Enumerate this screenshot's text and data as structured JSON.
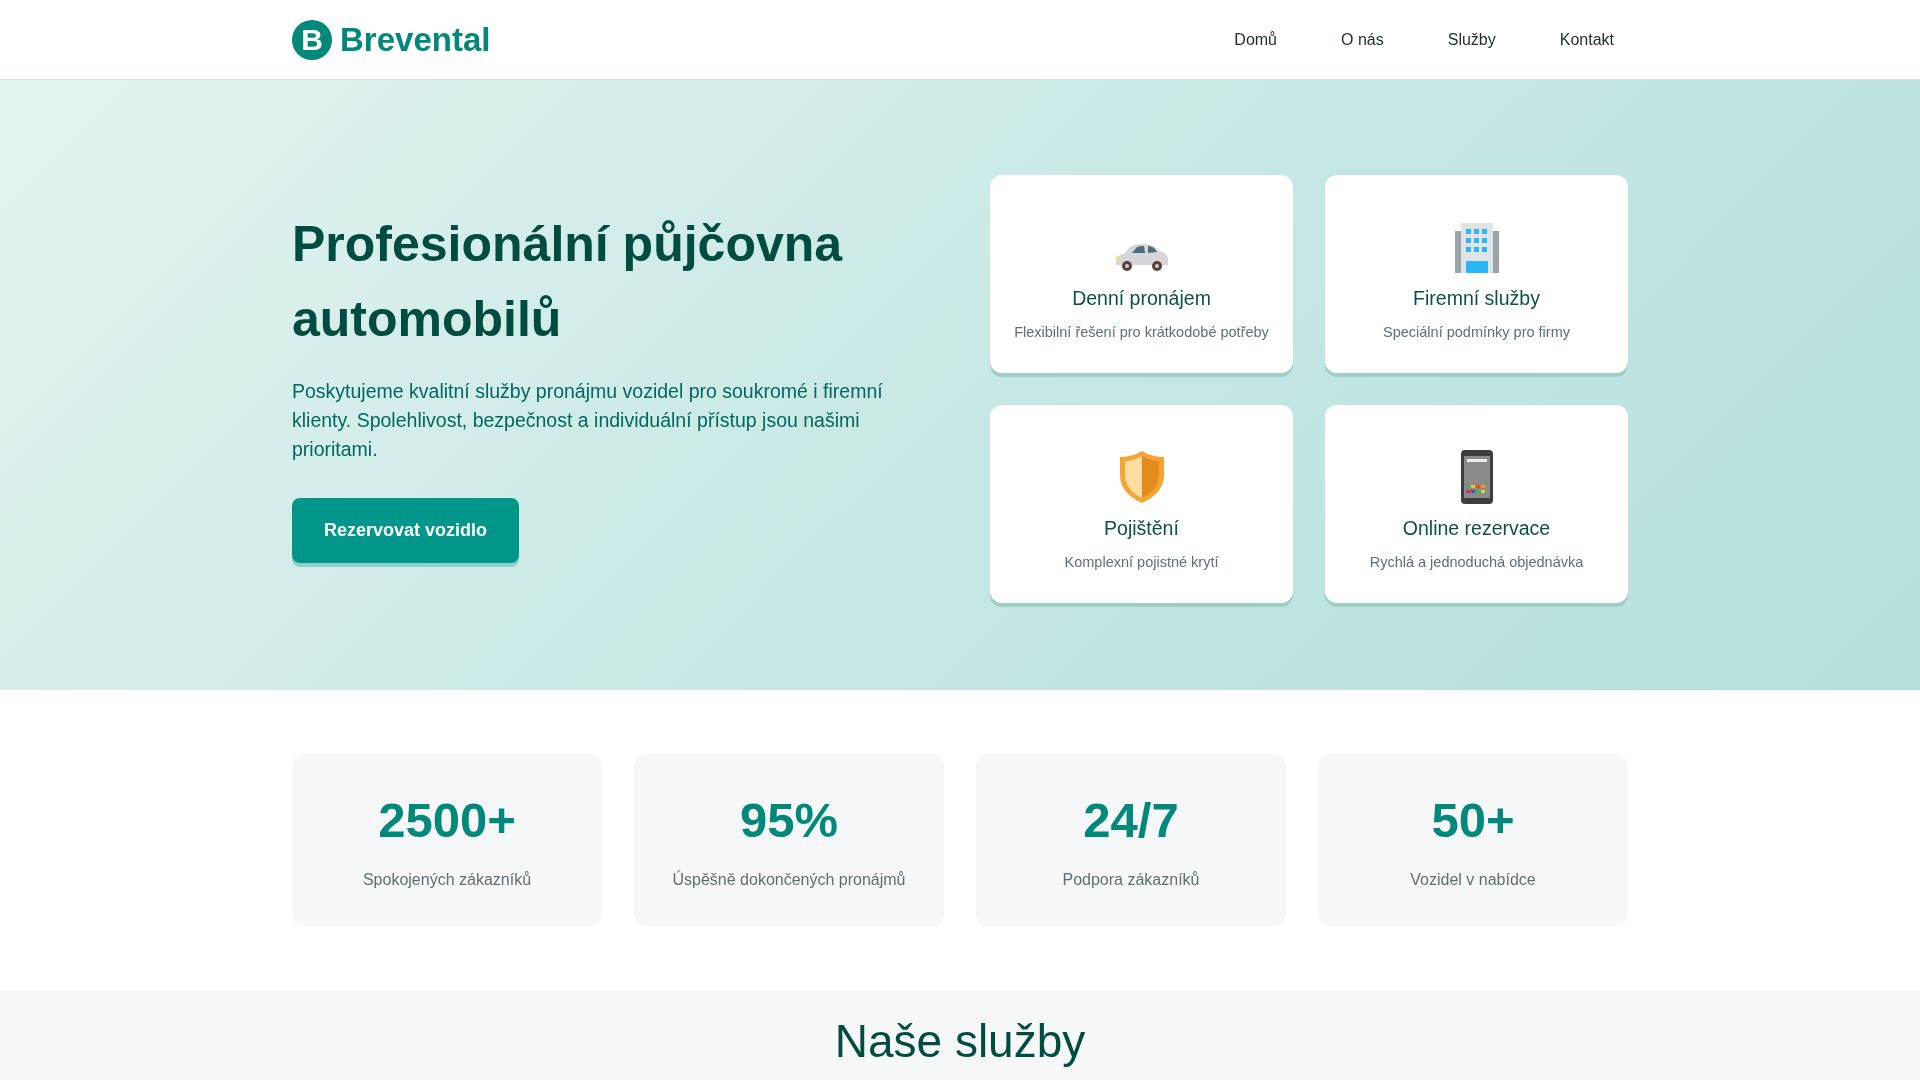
{
  "brand": {
    "initial": "B",
    "name": "Brevental"
  },
  "nav": [
    {
      "label": "Domů"
    },
    {
      "label": "O nás"
    },
    {
      "label": "Služby"
    },
    {
      "label": "Kontakt"
    }
  ],
  "hero": {
    "title": "Profesionální půjčovna automobilů",
    "text": "Poskytujeme kvalitní služby pronájmu vozidel pro soukromé i firemní klienty. Spolehlivost, bezpečnost a individuální přístup jsou našimi prioritami.",
    "button": "Rezervovat vozidlo"
  },
  "features": [
    {
      "kind": "car",
      "title": "Denní pronájem",
      "text": "Flexibilní řešení pro krátkodobé potřeby"
    },
    {
      "kind": "building",
      "title": "Firemní služby",
      "text": "Speciální podmínky pro firmy"
    },
    {
      "kind": "shield",
      "title": "Pojištění",
      "text": "Komplexní pojistné krytí"
    },
    {
      "kind": "phone",
      "title": "Online rezervace",
      "text": "Rychlá a jednoduchá objednávka"
    }
  ],
  "stats": [
    {
      "value": "2500+",
      "label": "Spokojených zákazníků"
    },
    {
      "value": "95%",
      "label": "Úspěšně dokončených pronájmů"
    },
    {
      "value": "24/7",
      "label": "Podpora zákazníků"
    },
    {
      "value": "50+",
      "label": "Vozidel v nabídce"
    }
  ],
  "services": {
    "heading": "Naše služby"
  }
}
